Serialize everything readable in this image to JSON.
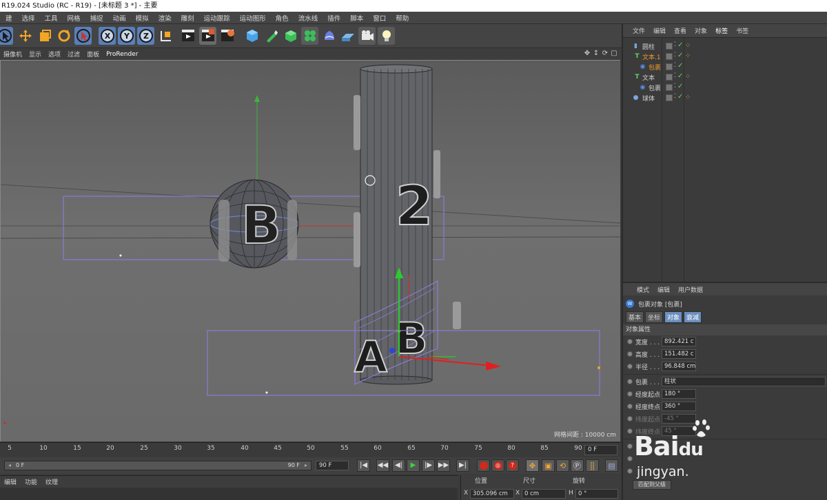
{
  "window": {
    "title": "R19.024 Studio (RC - R19) - [未标题 3 *] - 主要"
  },
  "menubar": [
    "建",
    "选择",
    "工具",
    "网格",
    "捕捉",
    "动画",
    "模拟",
    "渲染",
    "雕刻",
    "运动跟踪",
    "运动图形",
    "角色",
    "流水线",
    "插件",
    "脚本",
    "窗口",
    "帮助"
  ],
  "toolbar": {
    "icons": [
      "live-selection-icon",
      "move-icon",
      "scale-icon",
      "rotate-icon",
      "select-icon",
      "x-axis-icon",
      "y-axis-icon",
      "z-axis-icon",
      "coordinate-system-icon",
      "render-view-icon",
      "render-picture-viewer-icon",
      "render-settings-icon",
      "cube-icon",
      "pen-icon",
      "subdivision-icon",
      "cloner-icon",
      "deformer-icon",
      "floor-icon",
      "camera-icon",
      "light-icon"
    ],
    "axis_labels": {
      "x": "X",
      "y": "Y",
      "z": "Z"
    }
  },
  "viewport_menu": [
    "摄像机",
    "显示",
    "选项",
    "过滤",
    "面板",
    "ProRender"
  ],
  "viewport": {
    "grid_info": "网格间距 : 10000 cm",
    "labels": {
      "b_front": "B",
      "two": "2",
      "a_bottom": "A",
      "b_bottom": "B"
    }
  },
  "timeline": {
    "ticks": [
      "5",
      "10",
      "15",
      "20",
      "25",
      "30",
      "35",
      "40",
      "45",
      "50",
      "55",
      "60",
      "65",
      "70",
      "75",
      "80",
      "85",
      "90"
    ],
    "current_frame": "0 F",
    "slider_start": "0 F",
    "slider_end": "90 F",
    "end_frame": "90 F",
    "play_buttons": [
      "|◀",
      "◀◀",
      "◀|",
      "▶",
      "|▶",
      "▶▶",
      "▶|"
    ]
  },
  "material_menu": [
    "编辑",
    "功能",
    "纹理"
  ],
  "coordinates": {
    "headers": [
      "位置",
      "尺寸",
      "旋转"
    ],
    "position_x": "305.096 cm",
    "size_x": "0 cm",
    "rotation_h": "0 °",
    "axis_x": "X",
    "axis_x2": "X",
    "axis_h": "H"
  },
  "object_manager": {
    "menu": [
      "文件",
      "编辑",
      "查看",
      "对象",
      "标签",
      "书签"
    ],
    "active_menu": "标签",
    "objects": [
      {
        "label": "圆柱",
        "icon": "cylinder-icon",
        "color": "#7aa7e0",
        "indent": 0
      },
      {
        "label": "文本.1",
        "icon": "text-icon",
        "color": "#5fd35f",
        "indent": 0,
        "highlight": true
      },
      {
        "label": "包裹",
        "icon": "wrap-deformer-icon",
        "color": "#5b8fe8",
        "indent": 1
      },
      {
        "label": "文本",
        "icon": "text-icon",
        "color": "#5fd35f",
        "indent": 0
      },
      {
        "label": "包裹",
        "icon": "wrap-deformer-icon",
        "color": "#5b8fe8",
        "indent": 1
      },
      {
        "label": "球体",
        "icon": "sphere-icon",
        "color": "#7aa7e0",
        "indent": 0
      }
    ]
  },
  "attribute_manager": {
    "menu": [
      "模式",
      "编辑",
      "用户数据"
    ],
    "title": "包裹对象 [包裹]",
    "tabs": [
      "基本",
      "坐标",
      "对象",
      "衰减"
    ],
    "active_tab": "对象",
    "section": "对象属性",
    "fields": [
      {
        "label": "宽度 . . .",
        "value": "892.421 c"
      },
      {
        "label": "高度 . . .",
        "value": "151.482 c"
      },
      {
        "label": "半径 . . .",
        "value": "96.848 cm"
      }
    ],
    "wrap_label": "包裹 . . . . .",
    "wrap_value": "柱状",
    "angle_fields": [
      {
        "label": "经度起点",
        "value": "180 °",
        "disabled": false
      },
      {
        "label": "经度终点",
        "value": "360 °",
        "disabled": false
      },
      {
        "label": "纬度起点",
        "value": "-45 °",
        "disabled": true
      },
      {
        "label": "纬度终点",
        "value": "45 °",
        "disabled": true
      }
    ],
    "bottom_button": "匹配到父级"
  },
  "watermark": {
    "brand": "Bai",
    "brand_suffix": "du",
    "sub": "jingyan."
  }
}
